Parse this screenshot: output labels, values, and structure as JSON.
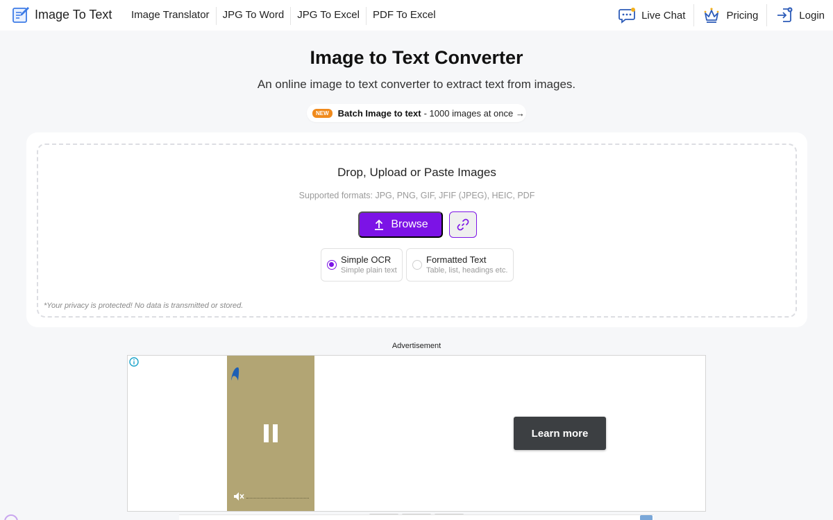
{
  "header": {
    "logo_text": "Image To Text",
    "nav": [
      {
        "label": "Image Translator"
      },
      {
        "label": "JPG To Word"
      },
      {
        "label": "JPG To Excel"
      },
      {
        "label": "PDF To Excel"
      }
    ],
    "actions": {
      "live_chat": "Live Chat",
      "pricing": "Pricing",
      "login": "Login"
    }
  },
  "hero": {
    "title": "Image to Text Converter",
    "subtitle": "An online image to text converter to extract text from images.",
    "batch": {
      "badge": "NEW",
      "strong": "Batch Image to text",
      "rest": "- 1000 images at once →"
    }
  },
  "upload": {
    "title": "Drop, Upload or Paste Images",
    "formats": "Supported formats: JPG, PNG, GIF, JFIF (JPEG), HEIC, PDF",
    "browse_label": "Browse",
    "options": [
      {
        "title": "Simple OCR",
        "desc": "Simple plain text",
        "selected": true
      },
      {
        "title": "Formatted Text",
        "desc": "Table, list, headings etc.",
        "selected": false
      }
    ],
    "privacy_note": "*Your privacy is protected! No data is transmitted or stored."
  },
  "ad": {
    "label": "Advertisement",
    "cta": "Learn more"
  },
  "colors": {
    "accent": "#7c13e6",
    "badge": "#f08a1c",
    "page_bg": "#f6f7f9",
    "ad_video_bg": "#b2a574",
    "ad_cta_bg": "#3c3f42"
  },
  "icons": [
    "pencil-doc-icon",
    "chat-bubble-icon",
    "crown-icon",
    "login-icon",
    "upload-arrow-icon",
    "link-icon",
    "info-icon",
    "pause-icon",
    "mute-icon"
  ]
}
